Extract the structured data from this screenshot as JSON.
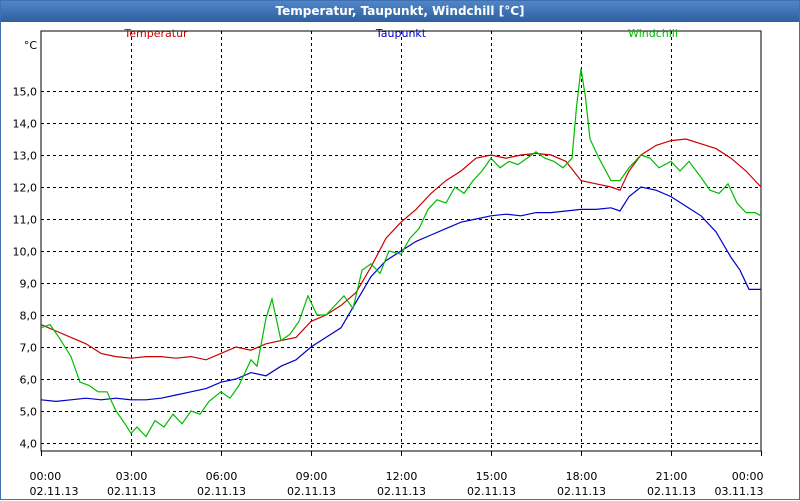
{
  "window": {
    "title": "Temperatur, Taupunkt, Windchill [°C]"
  },
  "chart_data": {
    "type": "line",
    "title": "Temperatur, Taupunkt, Windchill [°C]",
    "ylabel": "°C",
    "ylim": [
      3.75,
      16.25
    ],
    "xlim": [
      0,
      24
    ],
    "grid": true,
    "legend_position": "top",
    "yticks": [
      {
        "value": 4,
        "label": "4,0"
      },
      {
        "value": 5,
        "label": "5,0"
      },
      {
        "value": 6,
        "label": "6,0"
      },
      {
        "value": 7,
        "label": "7,0"
      },
      {
        "value": 8,
        "label": "8,0"
      },
      {
        "value": 9,
        "label": "9,0"
      },
      {
        "value": 10,
        "label": "10,0"
      },
      {
        "value": 11,
        "label": "11,0"
      },
      {
        "value": 12,
        "label": "12,0"
      },
      {
        "value": 13,
        "label": "13,0"
      },
      {
        "value": 14,
        "label": "14,0"
      },
      {
        "value": 15,
        "label": "15,0"
      }
    ],
    "xticks": [
      {
        "hour": 0,
        "time": "00:00",
        "date": "02.11.13"
      },
      {
        "hour": 3,
        "time": "03:00",
        "date": "02.11.13"
      },
      {
        "hour": 6,
        "time": "06:00",
        "date": "02.11.13"
      },
      {
        "hour": 9,
        "time": "09:00",
        "date": "02.11.13"
      },
      {
        "hour": 12,
        "time": "12:00",
        "date": "02.11.13"
      },
      {
        "hour": 15,
        "time": "15:00",
        "date": "02.11.13"
      },
      {
        "hour": 18,
        "time": "18:00",
        "date": "02.11.13"
      },
      {
        "hour": 21,
        "time": "21:00",
        "date": "02.11.13"
      },
      {
        "hour": 24,
        "time": "00:00",
        "date": "03.11.13"
      }
    ],
    "series": [
      {
        "name": "Temperatur",
        "color": "#cc0000",
        "points": [
          [
            0,
            7.7
          ],
          [
            0.5,
            7.5
          ],
          [
            1,
            7.3
          ],
          [
            1.5,
            7.1
          ],
          [
            2,
            6.8
          ],
          [
            2.5,
            6.7
          ],
          [
            3,
            6.65
          ],
          [
            3.5,
            6.7
          ],
          [
            4,
            6.7
          ],
          [
            4.5,
            6.65
          ],
          [
            5,
            6.7
          ],
          [
            5.5,
            6.6
          ],
          [
            6,
            6.8
          ],
          [
            6.5,
            7.0
          ],
          [
            7,
            6.9
          ],
          [
            7.5,
            7.1
          ],
          [
            8,
            7.2
          ],
          [
            8.5,
            7.3
          ],
          [
            9,
            7.8
          ],
          [
            9.5,
            8.0
          ],
          [
            10,
            8.3
          ],
          [
            10.5,
            8.7
          ],
          [
            11,
            9.5
          ],
          [
            11.5,
            10.4
          ],
          [
            12,
            10.9
          ],
          [
            12.5,
            11.3
          ],
          [
            13,
            11.8
          ],
          [
            13.5,
            12.2
          ],
          [
            14,
            12.5
          ],
          [
            14.5,
            12.9
          ],
          [
            15,
            13.0
          ],
          [
            15.5,
            12.9
          ],
          [
            16,
            13.0
          ],
          [
            16.5,
            13.05
          ],
          [
            17,
            13.0
          ],
          [
            17.5,
            12.8
          ],
          [
            18,
            12.2
          ],
          [
            18.5,
            12.1
          ],
          [
            19,
            12.0
          ],
          [
            19.3,
            11.9
          ],
          [
            19.6,
            12.5
          ],
          [
            20,
            13.0
          ],
          [
            20.5,
            13.3
          ],
          [
            21,
            13.45
          ],
          [
            21.5,
            13.5
          ],
          [
            22,
            13.35
          ],
          [
            22.5,
            13.2
          ],
          [
            23,
            12.9
          ],
          [
            23.5,
            12.5
          ],
          [
            24,
            12.0
          ]
        ]
      },
      {
        "name": "Taupunkt",
        "color": "#0000cc",
        "points": [
          [
            0,
            5.35
          ],
          [
            0.5,
            5.3
          ],
          [
            1,
            5.35
          ],
          [
            1.5,
            5.4
          ],
          [
            2,
            5.35
          ],
          [
            2.5,
            5.4
          ],
          [
            3,
            5.35
          ],
          [
            3.5,
            5.35
          ],
          [
            4,
            5.4
          ],
          [
            4.5,
            5.5
          ],
          [
            5,
            5.6
          ],
          [
            5.5,
            5.7
          ],
          [
            6,
            5.9
          ],
          [
            6.5,
            6.0
          ],
          [
            7,
            6.2
          ],
          [
            7.5,
            6.1
          ],
          [
            8,
            6.4
          ],
          [
            8.5,
            6.6
          ],
          [
            9,
            7.0
          ],
          [
            9.5,
            7.3
          ],
          [
            10,
            7.6
          ],
          [
            10.5,
            8.4
          ],
          [
            11,
            9.2
          ],
          [
            11.5,
            9.7
          ],
          [
            12,
            10.0
          ],
          [
            12.5,
            10.3
          ],
          [
            13,
            10.5
          ],
          [
            13.5,
            10.7
          ],
          [
            14,
            10.9
          ],
          [
            14.5,
            11.0
          ],
          [
            15,
            11.1
          ],
          [
            15.5,
            11.15
          ],
          [
            16,
            11.1
          ],
          [
            16.5,
            11.2
          ],
          [
            17,
            11.2
          ],
          [
            17.5,
            11.25
          ],
          [
            18,
            11.3
          ],
          [
            18.5,
            11.3
          ],
          [
            19,
            11.35
          ],
          [
            19.3,
            11.25
          ],
          [
            19.6,
            11.7
          ],
          [
            20,
            12.0
          ],
          [
            20.5,
            11.9
          ],
          [
            21,
            11.7
          ],
          [
            21.5,
            11.4
          ],
          [
            22,
            11.1
          ],
          [
            22.5,
            10.6
          ],
          [
            23,
            9.8
          ],
          [
            23.3,
            9.4
          ],
          [
            23.6,
            8.8
          ],
          [
            24,
            8.8
          ]
        ]
      },
      {
        "name": "Windchill",
        "color": "#00bb00",
        "points": [
          [
            0,
            7.6
          ],
          [
            0.3,
            7.7
          ],
          [
            0.6,
            7.3
          ],
          [
            1,
            6.7
          ],
          [
            1.3,
            5.9
          ],
          [
            1.6,
            5.8
          ],
          [
            1.9,
            5.6
          ],
          [
            2.2,
            5.6
          ],
          [
            2.5,
            5.0
          ],
          [
            2.8,
            4.6
          ],
          [
            3,
            4.3
          ],
          [
            3.2,
            4.5
          ],
          [
            3.5,
            4.2
          ],
          [
            3.8,
            4.7
          ],
          [
            4.1,
            4.5
          ],
          [
            4.4,
            4.9
          ],
          [
            4.7,
            4.6
          ],
          [
            5,
            5.0
          ],
          [
            5.3,
            4.9
          ],
          [
            5.6,
            5.3
          ],
          [
            6,
            5.6
          ],
          [
            6.3,
            5.4
          ],
          [
            6.6,
            5.8
          ],
          [
            7,
            6.6
          ],
          [
            7.2,
            6.4
          ],
          [
            7.5,
            7.9
          ],
          [
            7.7,
            8.5
          ],
          [
            8,
            7.2
          ],
          [
            8.3,
            7.4
          ],
          [
            8.6,
            7.8
          ],
          [
            8.9,
            8.6
          ],
          [
            9.2,
            8.0
          ],
          [
            9.5,
            8.0
          ],
          [
            9.8,
            8.3
          ],
          [
            10.1,
            8.6
          ],
          [
            10.4,
            8.2
          ],
          [
            10.7,
            9.4
          ],
          [
            11,
            9.6
          ],
          [
            11.3,
            9.3
          ],
          [
            11.6,
            10.0
          ],
          [
            12,
            9.9
          ],
          [
            12.3,
            10.4
          ],
          [
            12.6,
            10.7
          ],
          [
            12.9,
            11.3
          ],
          [
            13.2,
            11.6
          ],
          [
            13.5,
            11.5
          ],
          [
            13.8,
            12.0
          ],
          [
            14.1,
            11.8
          ],
          [
            14.4,
            12.2
          ],
          [
            14.7,
            12.5
          ],
          [
            15,
            12.9
          ],
          [
            15.3,
            12.6
          ],
          [
            15.6,
            12.8
          ],
          [
            15.9,
            12.7
          ],
          [
            16.2,
            12.9
          ],
          [
            16.5,
            13.1
          ],
          [
            16.8,
            12.9
          ],
          [
            17.1,
            12.8
          ],
          [
            17.4,
            12.6
          ],
          [
            17.7,
            12.9
          ],
          [
            17.85,
            14.5
          ],
          [
            18,
            15.7
          ],
          [
            18.15,
            14.8
          ],
          [
            18.3,
            13.5
          ],
          [
            18.6,
            12.9
          ],
          [
            19,
            12.2
          ],
          [
            19.3,
            12.2
          ],
          [
            19.6,
            12.6
          ],
          [
            20,
            13.0
          ],
          [
            20.3,
            12.9
          ],
          [
            20.6,
            12.6
          ],
          [
            21,
            12.8
          ],
          [
            21.3,
            12.5
          ],
          [
            21.6,
            12.8
          ],
          [
            22,
            12.3
          ],
          [
            22.3,
            11.9
          ],
          [
            22.6,
            11.8
          ],
          [
            22.9,
            12.1
          ],
          [
            23.2,
            11.5
          ],
          [
            23.5,
            11.2
          ],
          [
            23.8,
            11.2
          ],
          [
            24,
            11.1
          ]
        ]
      }
    ]
  }
}
